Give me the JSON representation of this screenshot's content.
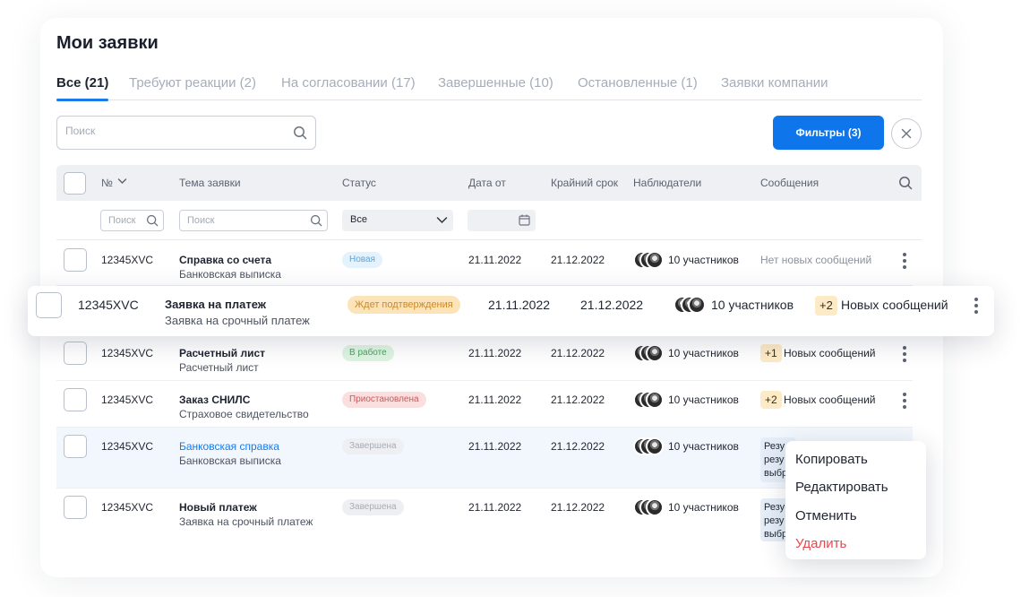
{
  "page": {
    "title": "Мои заявки"
  },
  "tabs": [
    {
      "label": "Все (21)"
    },
    {
      "label": "Требуют реакции (2)"
    },
    {
      "label": "На согласовании (17)"
    },
    {
      "label": "Завершенные (10)"
    },
    {
      "label": "Остановленные (1)"
    },
    {
      "label": "Заявки компании"
    }
  ],
  "search": {
    "placeholder": "Поиск"
  },
  "filters_button": {
    "label": "Фильтры (3)"
  },
  "table": {
    "headers": {
      "number": "№",
      "subject": "Тема заявки",
      "status": "Статус",
      "date_from": "Дата от",
      "deadline": "Крайний срок",
      "watchers": "Наблюдатели",
      "messages": "Сообщения"
    },
    "filters": {
      "number_placeholder": "Поиск",
      "subject_placeholder": "Поиск",
      "status_value": "Все"
    },
    "rows": [
      {
        "number": "12345XVC",
        "subject": "Справка со счета",
        "subtitle": "Банковская выписка",
        "status": "Новая",
        "date_from": "21.11.2022",
        "deadline": "21.12.2022",
        "watchers": "10 участников",
        "messages": "Нет новых сообщений"
      },
      {
        "number": "12345XVC",
        "subject": "Заявка на платеж",
        "subtitle": "Заявка на срочный платеж",
        "status": "Ждет подтверждения",
        "date_from": "21.11.2022",
        "deadline": "21.12.2022",
        "watchers": "10 участников",
        "msg_count": "+2",
        "messages": "Новых сообщений"
      },
      {
        "number": "12345XVC",
        "subject": "Расчетный лист",
        "subtitle": "Расчетный лист",
        "status": "В работе",
        "date_from": "21.11.2022",
        "deadline": "21.12.2022",
        "watchers": "10 участников",
        "msg_count": "+1",
        "messages": "Новых сообщений"
      },
      {
        "number": "12345XVC",
        "subject": "Заказ СНИЛС",
        "subtitle": "Страховое свидетельство",
        "status": "Приостановлена",
        "date_from": "21.11.2022",
        "deadline": "21.12.2022",
        "watchers": "10 участников",
        "msg_count": "+2",
        "messages": "Новых сообщений"
      },
      {
        "number": "12345XVC",
        "subject": "Банковская справка",
        "subtitle": "Банковская выписка",
        "status": "Завершена",
        "date_from": "21.11.2022",
        "deadline": "21.12.2022",
        "watchers": "10 участников",
        "messages": "Резу резу выбр"
      },
      {
        "number": "12345XVC",
        "subject": "Новый платеж",
        "subtitle": "Заявка на срочный платеж",
        "status": "Завершена",
        "date_from": "21.11.2022",
        "deadline": "21.12.2022",
        "watchers": "10 участников",
        "messages": "Резу резу выбр"
      }
    ]
  },
  "context_menu": [
    {
      "label": "Копировать"
    },
    {
      "label": "Редактировать"
    },
    {
      "label": "Отменить"
    },
    {
      "label": "Удалить"
    }
  ],
  "colors": {
    "accent": "#0e76ea",
    "link": "#1a7ae8",
    "danger": "#e5484d",
    "status_new_bg": "#e3f2fc",
    "status_new_fg": "#5aa7dc",
    "status_waiting_bg": "#fde3b8",
    "status_waiting_fg": "#c98a2a",
    "status_work_bg": "#dff5e2",
    "status_work_fg": "#3fa85a",
    "status_paused_bg": "#fbdede",
    "status_paused_fg": "#d1565a",
    "status_done_bg": "#eeeff2",
    "status_done_fg": "#a6abb5"
  }
}
